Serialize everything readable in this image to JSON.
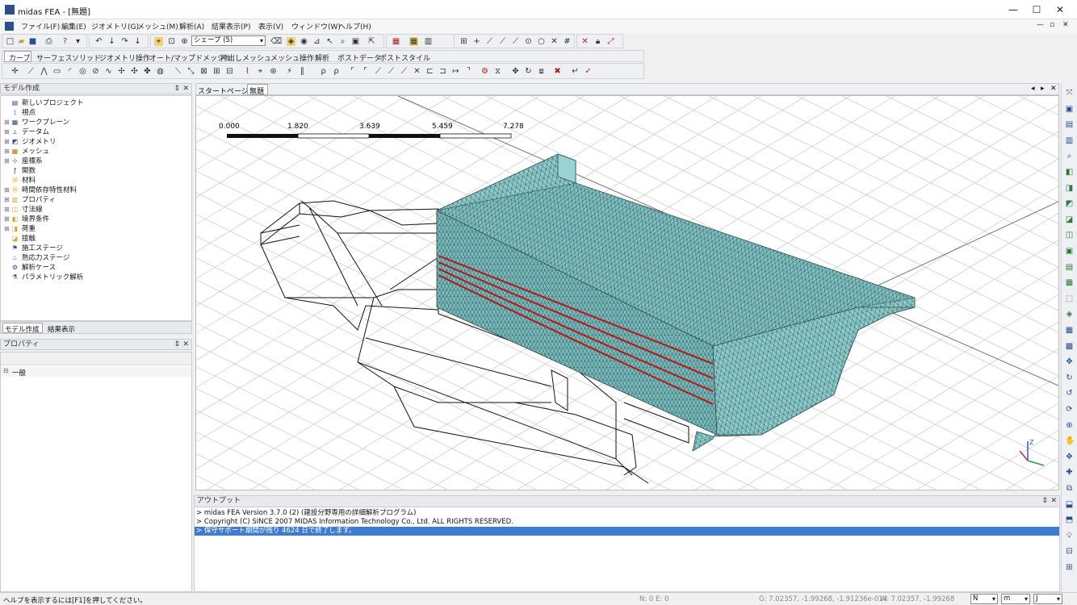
{
  "window": {
    "title": "midas FEA - [無題]",
    "buttons": {
      "minimize": "—",
      "maximize": "☐",
      "close": "✕"
    }
  },
  "menu": {
    "items": [
      "ファイル(F)",
      "編集(E)",
      "ジオメトリ(G)",
      "メッシュ(M)",
      "解析(A)",
      "結果表示(P)",
      "表示(V)",
      "ウィンドウ(W)",
      "ヘルプ(H)"
    ],
    "mdi_buttons": [
      "—",
      "▫",
      "✕"
    ]
  },
  "toolbar": {
    "shape_combo": "シェープ (5)"
  },
  "ribbon_tabs": [
    "カーブ",
    "サーフェス",
    "ソリッド",
    "ジオメトリ操作",
    "オート/マップドメッシュ",
    "押出しメッシュ",
    "メッシュ操作",
    "解析",
    "ポストデータ",
    "ポストスタイル"
  ],
  "model_panel": {
    "title": "モデル作成",
    "tree": [
      {
        "label": "新しいプロジェクト",
        "icon": "project-icon",
        "expander": ""
      },
      {
        "label": "視点",
        "icon": "viewpoint-icon",
        "expander": ""
      },
      {
        "label": "ワークプレーン",
        "icon": "workplane-icon",
        "expander": "⊞"
      },
      {
        "label": "データム",
        "icon": "datum-icon",
        "expander": "⊞"
      },
      {
        "label": "ジオメトリ",
        "icon": "geometry-icon",
        "expander": "⊞"
      },
      {
        "label": "メッシュ",
        "icon": "mesh-icon",
        "expander": "⊞"
      },
      {
        "label": "座標系",
        "icon": "coordinate-icon",
        "expander": "⊞"
      },
      {
        "label": "関数",
        "icon": "function-icon",
        "expander": ""
      },
      {
        "label": "材料",
        "icon": "material-icon",
        "expander": ""
      },
      {
        "label": "時間依存特性材料",
        "icon": "time-material-icon",
        "expander": "⊞"
      },
      {
        "label": "プロパティ",
        "icon": "property-icon",
        "expander": "⊞"
      },
      {
        "label": "寸法線",
        "icon": "dimension-icon",
        "expander": "⊞"
      },
      {
        "label": "境界条件",
        "icon": "boundary-icon",
        "expander": "⊞"
      },
      {
        "label": "荷重",
        "icon": "load-icon",
        "expander": "⊞"
      },
      {
        "label": "接触",
        "icon": "contact-icon",
        "expander": ""
      },
      {
        "label": "施工ステージ",
        "icon": "construction-stage-icon",
        "expander": ""
      },
      {
        "label": "熱応力ステージ",
        "icon": "heat-stage-icon",
        "expander": ""
      },
      {
        "label": "解析ケース",
        "icon": "analysis-case-icon",
        "expander": ""
      },
      {
        "label": "パラメトリック解析",
        "icon": "parametric-icon",
        "expander": ""
      }
    ],
    "tabs": [
      "モデル作成",
      "結果表示"
    ]
  },
  "property_panel": {
    "title": "プロパティ",
    "group": "一般"
  },
  "doc_tabs": [
    "スタートページ",
    "無題"
  ],
  "scale_bar": {
    "labels": [
      "0.000",
      "1.820",
      "3.639",
      "5.459",
      "7.278"
    ]
  },
  "output": {
    "title": "アウトプット",
    "lines": [
      "> midas FEA Version 3.7.0 (2) (建設分野専用の詳細解析プログラム)",
      "> Copyright (C) SINCE 2007 MIDAS Information Technology Co., Ltd. ALL RIGHTS RESERVED.",
      "> 保守サポート期間が残り 4624 日で終了します。"
    ]
  },
  "status": {
    "help": "ヘルプを表示するには[F1]を押してください。",
    "ne": "N: 0  E: 0",
    "g": "G: 7.02357, -1.99268, -1.91236e-014",
    "w": "W: 7.02357, -1.99268",
    "unit_force": "N",
    "unit_length": "m",
    "unit_energy": "J"
  },
  "colors": {
    "mesh_fill": "#88c8c8",
    "tendon": "#b02020",
    "highlight": "#3f7cd0"
  }
}
